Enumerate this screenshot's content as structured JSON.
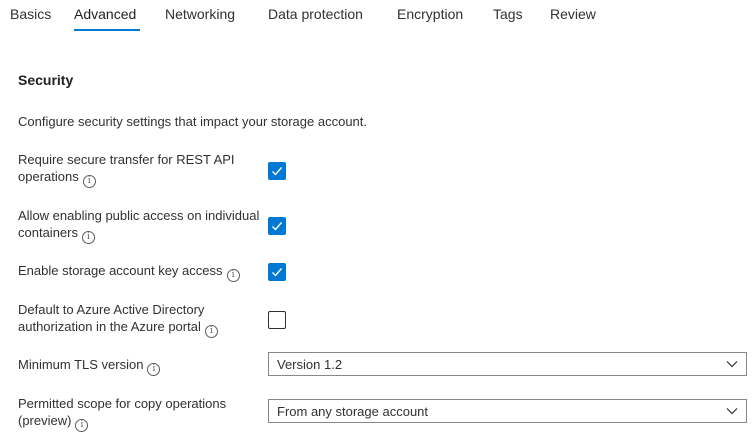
{
  "tabs": [
    {
      "label": "Basics"
    },
    {
      "label": "Advanced"
    },
    {
      "label": "Networking"
    },
    {
      "label": "Data protection"
    },
    {
      "label": "Encryption"
    },
    {
      "label": "Tags"
    },
    {
      "label": "Review"
    }
  ],
  "active_tab": "Advanced",
  "colors": {
    "accent": "#0078d4"
  },
  "section": {
    "title": "Security",
    "description": "Configure security settings that impact your storage account."
  },
  "settings": {
    "secure_transfer": {
      "label": "Require secure transfer for REST API operations",
      "checked": true
    },
    "public_access": {
      "label": "Allow enabling public access on individual containers",
      "checked": true
    },
    "key_access": {
      "label": "Enable storage account key access",
      "checked": true
    },
    "aad_default": {
      "label": "Default to Azure Active Directory authorization in the Azure portal",
      "checked": false
    },
    "min_tls": {
      "label": "Minimum TLS version",
      "value": "Version 1.2"
    },
    "copy_scope": {
      "label": "Permitted scope for copy operations (preview)",
      "value": "From any storage account"
    }
  },
  "icons": {
    "info": "info-icon",
    "check": "checkmark-icon",
    "dropdown": "chevron-down-icon"
  }
}
